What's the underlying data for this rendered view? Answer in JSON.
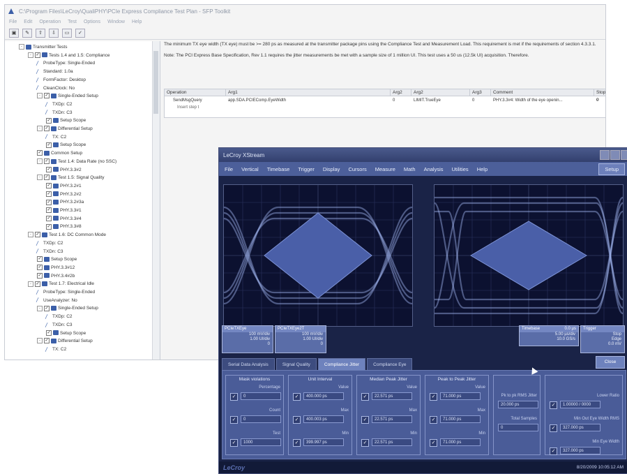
{
  "window": {
    "title": "C:\\Program Files\\LeCroy\\QualiPHY\\PCIe Express Compliance Test Plan - SFP Toolkit",
    "menu": [
      "File",
      "Edit",
      "Operation",
      "Test",
      "Options",
      "Window",
      "Help"
    ]
  },
  "toolbar": {
    "buttons": [
      "▣",
      "✎",
      "⇧",
      "⇩",
      "▭",
      "✓"
    ]
  },
  "tree": {
    "items": [
      {
        "label": "Transmitter Tests",
        "depth": 0,
        "pm": "-",
        "cb": "",
        "icon": "folder"
      },
      {
        "label": "Tests 1.4 and 1.5: Compliance",
        "depth": 1,
        "pm": "-",
        "cb": "✓",
        "icon": "folder"
      },
      {
        "label": "ProbeType: Single-Ended",
        "depth": 2,
        "pm": "",
        "cb": "",
        "icon": "leaf"
      },
      {
        "label": "Standard: 1.0a",
        "depth": 2,
        "pm": "",
        "cb": "",
        "icon": "leaf"
      },
      {
        "label": "FormFactor: Desktop",
        "depth": 2,
        "pm": "",
        "cb": "",
        "icon": "leaf"
      },
      {
        "label": "CleanClock: No",
        "depth": 2,
        "pm": "",
        "cb": "",
        "icon": "leaf"
      },
      {
        "label": "Single-Ended Setup",
        "depth": 2,
        "pm": "-",
        "cb": "✓",
        "icon": "folder"
      },
      {
        "label": "TXDp: C2",
        "depth": 3,
        "pm": "",
        "cb": "",
        "icon": "leaf"
      },
      {
        "label": "TXDn: C3",
        "depth": 3,
        "pm": "",
        "cb": "",
        "icon": "leaf"
      },
      {
        "label": "Setup Scope",
        "depth": 3,
        "pm": "",
        "cb": "✓",
        "icon": "folder"
      },
      {
        "label": "Differential Setup",
        "depth": 2,
        "pm": "-",
        "cb": "✓",
        "icon": "folder"
      },
      {
        "label": "TX: C2",
        "depth": 3,
        "pm": "",
        "cb": "",
        "icon": "leaf"
      },
      {
        "label": "Setup Scope",
        "depth": 3,
        "pm": "",
        "cb": "✓",
        "icon": "folder"
      },
      {
        "label": "Common Setup",
        "depth": 2,
        "pm": "",
        "cb": "✓",
        "icon": "folder"
      },
      {
        "label": "Test 1.4: Data Rate (no SSC)",
        "depth": 2,
        "pm": "-",
        "cb": "✓",
        "icon": "folder"
      },
      {
        "label": "PHY.3.3#2",
        "depth": 3,
        "pm": "",
        "cb": "✓",
        "icon": "folder"
      },
      {
        "label": "Test 1.5: Signal Quality",
        "depth": 2,
        "pm": "-",
        "cb": "✓",
        "icon": "folder"
      },
      {
        "label": "PHY.3.2#1",
        "depth": 3,
        "pm": "",
        "cb": "✓",
        "icon": "folder"
      },
      {
        "label": "PHY.3.2#2",
        "depth": 3,
        "pm": "",
        "cb": "✓",
        "icon": "folder"
      },
      {
        "label": "PHY.3.2#3a",
        "depth": 3,
        "pm": "",
        "cb": "✓",
        "icon": "folder"
      },
      {
        "label": "PHY.3.3#1",
        "depth": 3,
        "pm": "",
        "cb": "✓",
        "icon": "folder"
      },
      {
        "label": "PHY.3.3#4",
        "depth": 3,
        "pm": "",
        "cb": "✓",
        "icon": "folder"
      },
      {
        "label": "PHY.3.3#8",
        "depth": 3,
        "pm": "",
        "cb": "✓",
        "icon": "folder"
      },
      {
        "label": "Test 1.6: DC Common Mode",
        "depth": 1,
        "pm": "-",
        "cb": "✓",
        "icon": "folder"
      },
      {
        "label": "TXDp: C2",
        "depth": 2,
        "pm": "",
        "cb": "",
        "icon": "leaf"
      },
      {
        "label": "TXDn: C3",
        "depth": 2,
        "pm": "",
        "cb": "",
        "icon": "leaf"
      },
      {
        "label": "Setup Scope",
        "depth": 2,
        "pm": "",
        "cb": "✓",
        "icon": "folder"
      },
      {
        "label": "PHY.3.3#12",
        "depth": 2,
        "pm": "",
        "cb": "✓",
        "icon": "folder"
      },
      {
        "label": "PHY.3.4#2b",
        "depth": 2,
        "pm": "",
        "cb": "✓",
        "icon": "folder"
      },
      {
        "label": "Test 1.7: Electrical Idle",
        "depth": 1,
        "pm": "-",
        "cb": "✓",
        "icon": "folder"
      },
      {
        "label": "ProbeType: Single-Ended",
        "depth": 2,
        "pm": "",
        "cb": "",
        "icon": "leaf"
      },
      {
        "label": "UseAnalyzer: No",
        "depth": 2,
        "pm": "",
        "cb": "",
        "icon": "leaf"
      },
      {
        "label": "Single-Ended Setup",
        "depth": 2,
        "pm": "-",
        "cb": "✓",
        "icon": "folder"
      },
      {
        "label": "TXDp: C2",
        "depth": 3,
        "pm": "",
        "cb": "",
        "icon": "leaf"
      },
      {
        "label": "TXDn: C3",
        "depth": 3,
        "pm": "",
        "cb": "",
        "icon": "leaf"
      },
      {
        "label": "Setup Scope",
        "depth": 3,
        "pm": "",
        "cb": "✓",
        "icon": "folder"
      },
      {
        "label": "Differential Setup",
        "depth": 2,
        "pm": "-",
        "cb": "✓",
        "icon": "folder"
      },
      {
        "label": "TX: C2",
        "depth": 3,
        "pm": "",
        "cb": "",
        "icon": "leaf"
      }
    ]
  },
  "description": {
    "p1": "The minimum TX eye width (TX eye) must be >= 280 ps as measured at the transmitter package pins using the Compliance Test and Measurement Load. This requirement is met if the requirements of section 4.3.3.1.",
    "p2": "Note: The PCI Express Base Specification, Rev 1.1 requires the jitter measurements be met with a sample size of 1 million UI. This test uses a 50 us (12.5k UI) acquisition. Therefore."
  },
  "table": {
    "headers": [
      "Operation",
      "Arg1",
      "Arg2",
      "Arg2",
      "Arg3",
      "Comment",
      "Stop o"
    ],
    "rows": [
      [
        "SendMsgQuery",
        "app.SDA.PCIEComp.EyeWidth",
        "0",
        "LIMIT.TrueEye",
        "0",
        "PHY.3.3#4: Width of the eye openin...",
        "0"
      ],
      [
        "Insert step t",
        "",
        "",
        "",
        "",
        "",
        ""
      ]
    ]
  },
  "scope": {
    "title": "LeCroy XStream",
    "menu": [
      "File",
      "Vertical",
      "Timebase",
      "Trigger",
      "Display",
      "Cursors",
      "Measure",
      "Math",
      "Analysis",
      "Utilities",
      "Help"
    ],
    "setup_label": "Setup",
    "info_left": [
      {
        "title": "PCIeTXEye",
        "rows": [
          "100 mV/div",
          "1.00 UI/div",
          "0"
        ]
      },
      {
        "title": "PCIeTXEye2T",
        "rows": [
          "100 mV/div",
          "1.00 UI/div",
          "0"
        ]
      }
    ],
    "timebase": {
      "title": "Timebase",
      "value": "0.0 µs",
      "rows": [
        "5.00 µs/div",
        "10.0 GS/s"
      ]
    },
    "trigger": {
      "title": "Trigger",
      "rows": [
        "Stop",
        "Edge",
        "0.0 mV",
        "Positive"
      ]
    },
    "tabs": [
      "Serial Data Analysis",
      "Signal Quality",
      "Compliance Jitter",
      "Compliance Eye"
    ],
    "active_tab": "Compliance Jitter",
    "close_label": "Close",
    "groups": [
      {
        "title": "Mask violations",
        "controls": [
          {
            "label": "Percentage",
            "value": "0"
          },
          {
            "label": "Count",
            "value": "0"
          },
          {
            "label": "Test",
            "value": "1000"
          }
        ]
      },
      {
        "title": "Unit Interval",
        "controls": [
          {
            "label": "Value",
            "value": "400.000 ps"
          },
          {
            "label": "Max",
            "value": "400.003 ps"
          },
          {
            "label": "Min",
            "value": "399.997 ps"
          }
        ]
      },
      {
        "title": "Median Peak Jitter",
        "controls": [
          {
            "label": "Value",
            "value": "22.571 ps"
          },
          {
            "label": "Max",
            "value": "22.571 ps"
          },
          {
            "label": "Min",
            "value": "22.571 ps"
          }
        ]
      },
      {
        "title": "Peak to Peak Jitter",
        "controls": [
          {
            "label": "Value",
            "value": "71.000 ps"
          },
          {
            "label": "Max",
            "value": "71.000 ps"
          },
          {
            "label": "Min",
            "value": "71.000 ps"
          }
        ]
      },
      {
        "title": "",
        "controls": [
          {
            "label": "Pk to pk RMS Jitter",
            "value": "20.000 ps"
          },
          {
            "label": "Total Samples",
            "value": "0"
          }
        ]
      },
      {
        "title": "",
        "controls": [
          {
            "label": "Lower Ratio",
            "value": "1.00000 / 0000"
          },
          {
            "label": "Min Out Eye Width RMS",
            "value": "327.000 ps"
          },
          {
            "label": "Min Eye Width",
            "value": "327.000 ps"
          }
        ]
      }
    ],
    "brand": "LeCroy",
    "clock": "8/20/2009 10:05:12 AM"
  }
}
